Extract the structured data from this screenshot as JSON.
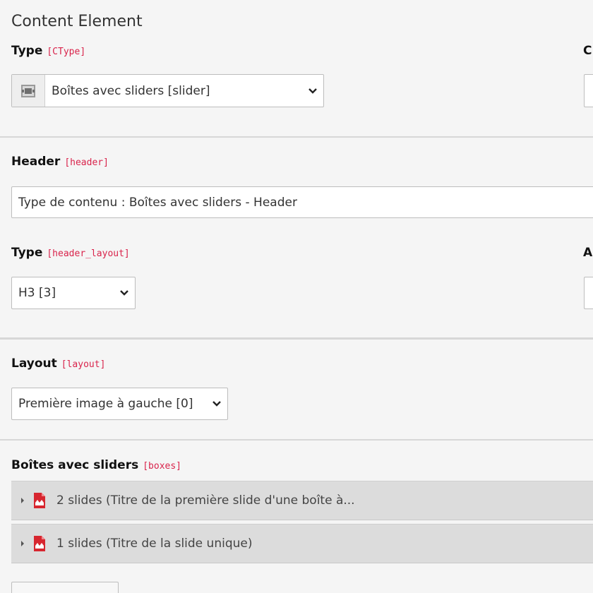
{
  "section": {
    "title": "Content Element"
  },
  "ctype": {
    "label": "Type",
    "code": "[CType]",
    "selected": "Boîtes avec sliders [slider]",
    "icon": "content-element-icon"
  },
  "right_column": {
    "ctype_neighbor_label": "C",
    "header_neighbor_label": "A"
  },
  "header": {
    "label": "Header",
    "code": "[header]",
    "value": "Type de contenu : Boîtes avec sliders - Header"
  },
  "header_layout": {
    "label": "Type",
    "code": "[header_layout]",
    "selected": "H3 [3]"
  },
  "layout": {
    "label": "Layout",
    "code": "[layout]",
    "selected": "Première image à gauche [0]"
  },
  "boxes": {
    "label": "Boîtes avec sliders",
    "code": "[boxes]",
    "items": [
      {
        "label": "2 slides (Titre de la première slide d'une boîte à..."
      },
      {
        "label": "1 slides (Titre de la slide unique)"
      }
    ]
  },
  "colors": {
    "code_red": "#d9234b",
    "icon_red": "#d7262f",
    "background": "#f5f5f5",
    "separator": "#d7d7d7",
    "record_row": "#dcdcdc"
  }
}
